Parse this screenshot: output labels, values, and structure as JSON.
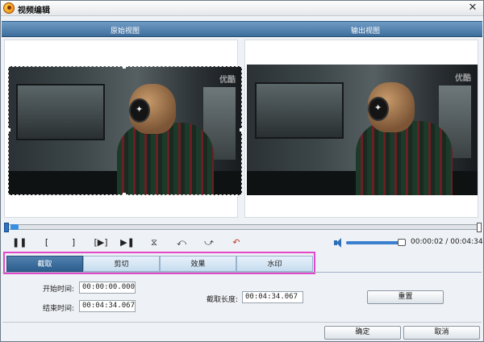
{
  "window": {
    "title": "视频编辑",
    "close_glyph": "✕"
  },
  "headers": {
    "original_view": "原始视图",
    "output_view": "输出视图"
  },
  "video": {
    "watermark": "优酷"
  },
  "controls": {
    "pause_glyph": "❚❚",
    "mark_in_glyph": "[",
    "mark_out_glyph": "]",
    "play_segment_glyph": "[▶]",
    "play_pause_glyph": "▶❚",
    "flip_vertical_glyph": "⧖",
    "rotate_left_glyph": "⤺",
    "rotate_right_glyph": "⤻",
    "undo_glyph": "↶",
    "volume_level": 0.9,
    "time_current": "00:00:02",
    "time_total": "00:04:34",
    "time_separator": " / "
  },
  "tabs": [
    {
      "label": "截取",
      "active": true
    },
    {
      "label": "剪切",
      "active": false
    },
    {
      "label": "效果",
      "active": false
    },
    {
      "label": "水印",
      "active": false
    }
  ],
  "form": {
    "start_label": "开始时间:",
    "start_value": "00:00:00.000",
    "end_label": "结束时间:",
    "end_value": "00:04:34.067",
    "length_label": "截取长度:",
    "length_value": "00:04:34.067",
    "reset_label": "重置"
  },
  "footer": {
    "ok_label": "确定",
    "cancel_label": "取消"
  },
  "colors": {
    "header_blue": "#3e6e9c",
    "tab_active": "#2e5e8e",
    "highlight": "#e04ac8",
    "accent": "#2b74c8"
  },
  "icons": [
    "app-icon",
    "close-icon",
    "pause-icon",
    "mark-in-icon",
    "mark-out-icon",
    "play-segment-icon",
    "play-pause-icon",
    "flip-vertical-icon",
    "rotate-left-icon",
    "rotate-right-icon",
    "undo-icon",
    "volume-icon"
  ]
}
